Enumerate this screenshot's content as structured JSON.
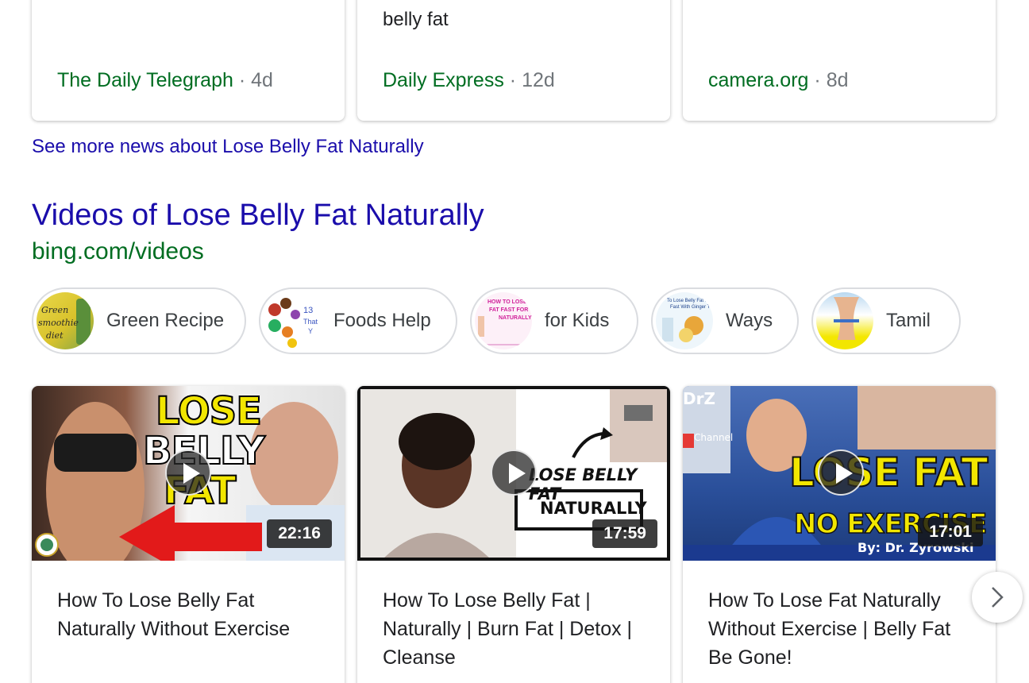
{
  "news": {
    "cards": [
      {
        "title": "",
        "source": "The Daily Telegraph",
        "separator": "·",
        "age": "4d"
      },
      {
        "title": "belly fat",
        "source": "Daily Express",
        "separator": "·",
        "age": "12d"
      },
      {
        "title": "",
        "source": "camera.org",
        "separator": "·",
        "age": "8d"
      }
    ],
    "see_more": "See more news about Lose Belly Fat Naturally"
  },
  "videos": {
    "heading": "Videos of Lose Belly Fat Naturally",
    "url": "bing.com/videos",
    "chips": [
      {
        "label": "Green Recipe",
        "thumb_text": "Green smoothie diet"
      },
      {
        "label": "Foods Help",
        "thumb_text": "13 That Y"
      },
      {
        "label": "for Kids",
        "thumb_text": "HOW TO LOSE FAT FAST FOR NATURALLY"
      },
      {
        "label": "Ways",
        "thumb_text": "To Lose Belly Fat Natur. Fast With Ginger Tea"
      },
      {
        "label": "Tamil",
        "thumb_text": ""
      }
    ],
    "cards": [
      {
        "title": "How To Lose Belly Fat Naturally Without Exercise",
        "duration": "22:16",
        "thumb_lines": [
          "LOSE",
          "BELLY",
          "FAT"
        ]
      },
      {
        "title": "How To Lose Belly Fat | Naturally | Burn Fat | Detox | Cleanse",
        "duration": "17:59",
        "thumb_lines": [
          "LOSE BELLY FAT",
          "NATURALLY"
        ]
      },
      {
        "title": "How To Lose Fat Naturally Without Exercise | Belly Fat Be Gone!",
        "duration": "17:01",
        "thumb_lines": [
          "LOSE FAT",
          "NO EXERCISE",
          "By: Dr. Zyrowski",
          "DrZ",
          "Channel"
        ]
      }
    ],
    "next_icon": "chevron-right-icon"
  },
  "colors": {
    "link": "#1a0dab",
    "source_green": "#006d21",
    "meta_gray": "#70757a",
    "thumb_yellow": "#f2e600"
  }
}
